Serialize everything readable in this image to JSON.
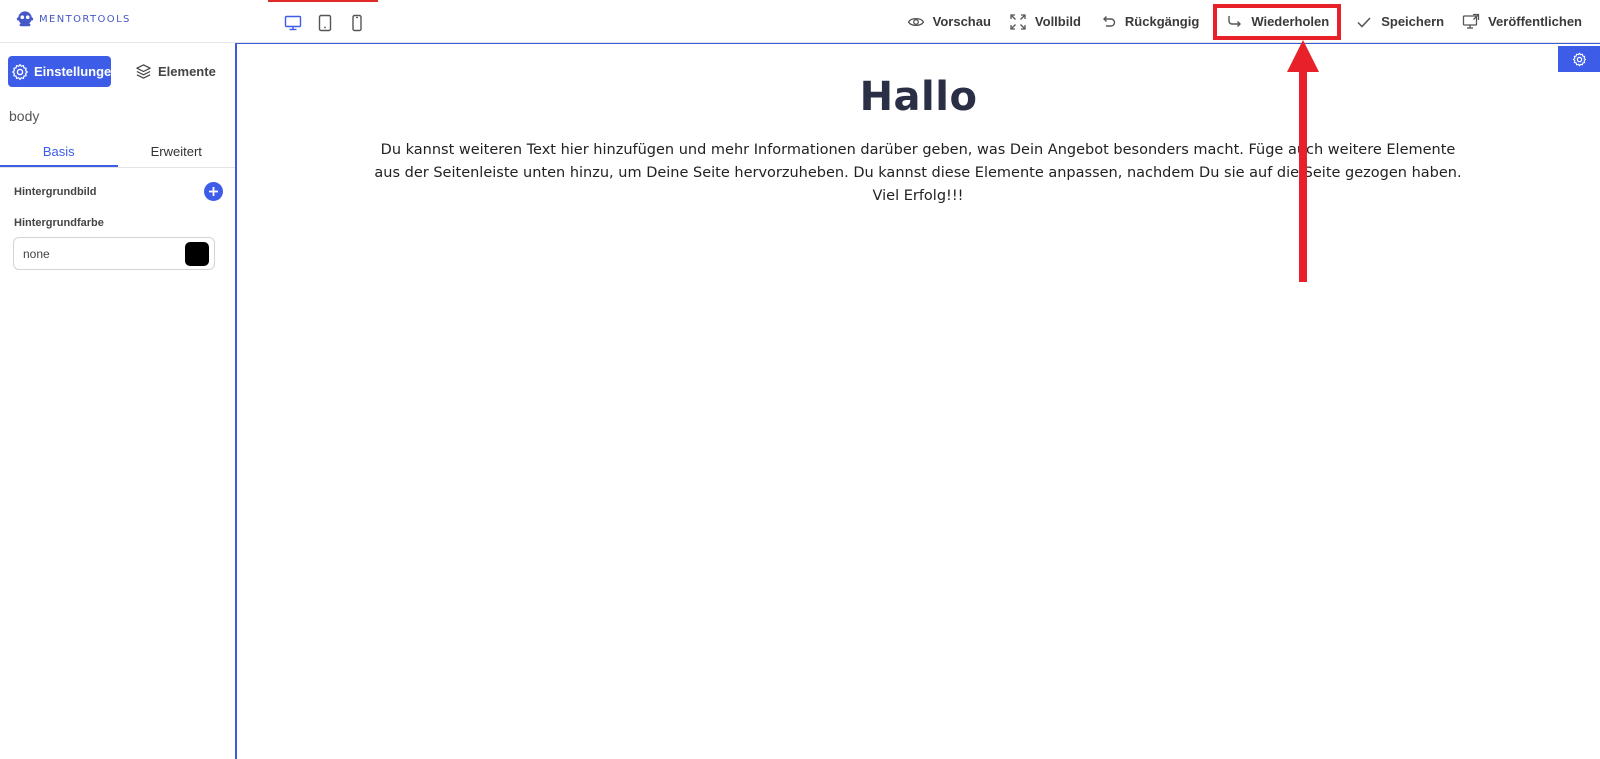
{
  "app": {
    "brand": "MENTORTOOLS",
    "accent": "#3d5ce8",
    "highlight": "#e8202a"
  },
  "devices": [
    {
      "name": "desktop",
      "icon": "desktop-icon"
    },
    {
      "name": "tablet",
      "icon": "tablet-icon"
    },
    {
      "name": "mobile",
      "icon": "mobile-icon"
    }
  ],
  "toolbar": {
    "preview": "Vorschau",
    "fullscreen": "Vollbild",
    "undo": "Rückgängig",
    "redo": "Wiederholen",
    "save": "Speichern",
    "publish": "Veröffentlichen"
  },
  "sidebar": {
    "tab_settings": "Einstellungen",
    "tab_elements": "Elemente",
    "selected_element": "body",
    "subtab_basic": "Basis",
    "subtab_advanced": "Erweitert",
    "bg_image_label": "Hintergrundbild",
    "bg_color_label": "Hintergrundfarbe",
    "bg_color_value": "none",
    "bg_color_swatch": "#000000"
  },
  "canvas": {
    "title": "Hallo",
    "text": "Du kannst weiteren Text hier hinzufügen und mehr Informationen darüber geben, was Dein Angebot besonders macht. Füge auch weitere Elemente aus der Seitenleiste unten hinzu, um Deine Seite hervorzuheben. Du kannst diese Elemente anpassen, nachdem Du sie auf die Seite gezogen haben. Viel Erfolg!!!"
  }
}
